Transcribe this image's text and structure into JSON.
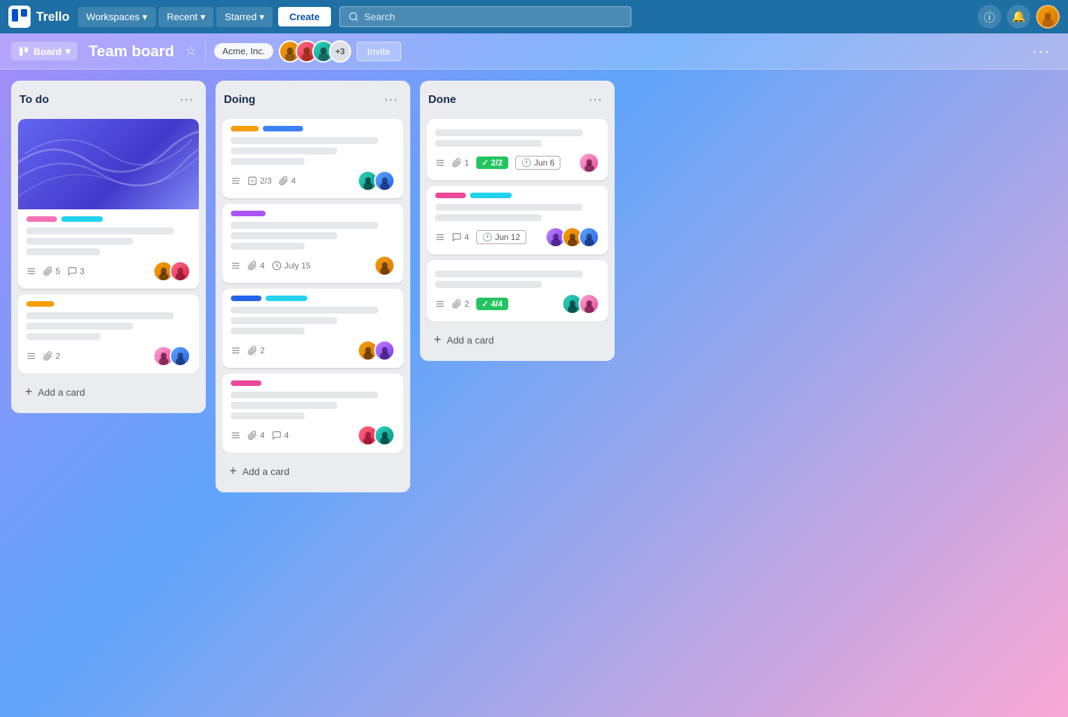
{
  "topnav": {
    "brand": "Trello",
    "workspaces": "Workspaces",
    "recent": "Recent",
    "starred": "Starred",
    "create": "Create",
    "search_placeholder": "Search"
  },
  "board_header": {
    "view_label": "Board",
    "title": "Team board",
    "workspace": "Acme, Inc.",
    "more_members": "+3",
    "invite": "Invite"
  },
  "columns": [
    {
      "id": "todo",
      "title": "To do",
      "cards": [
        {
          "id": "todo-1",
          "has_cover": true,
          "labels": [
            "pink",
            "cyan"
          ],
          "lines": [
            "long",
            "medium",
            "short"
          ],
          "meta": [
            {
              "icon": "☰",
              "text": ""
            },
            {
              "icon": "📎",
              "text": "5"
            },
            {
              "icon": "💬",
              "text": "3"
            }
          ],
          "members": [
            "amber",
            "rose"
          ]
        },
        {
          "id": "todo-2",
          "has_cover": false,
          "labels": [
            "yellow"
          ],
          "lines": [
            "long",
            "medium",
            "short"
          ],
          "meta": [
            {
              "icon": "☰",
              "text": ""
            },
            {
              "icon": "📎",
              "text": "2"
            }
          ],
          "members": [
            "pink",
            "blue"
          ]
        }
      ],
      "add_card": "Add a card"
    },
    {
      "id": "doing",
      "title": "Doing",
      "cards": [
        {
          "id": "doing-1",
          "has_cover": false,
          "labels": [
            "yellow",
            "blue"
          ],
          "lines": [
            "long",
            "medium",
            "short"
          ],
          "meta": [
            {
              "icon": "☰",
              "text": ""
            },
            {
              "icon": "✓",
              "text": "2/3"
            },
            {
              "icon": "📎",
              "text": "4"
            }
          ],
          "members": [
            "teal",
            "blue"
          ]
        },
        {
          "id": "doing-2",
          "has_cover": false,
          "labels": [
            "purple"
          ],
          "lines": [
            "long",
            "medium",
            "short"
          ],
          "meta": [
            {
              "icon": "☰",
              "text": ""
            },
            {
              "icon": "📎",
              "text": "4"
            },
            {
              "icon": "🕐",
              "text": "July 15"
            }
          ],
          "members": [
            "amber"
          ]
        },
        {
          "id": "doing-3",
          "has_cover": false,
          "labels": [
            "blue-dark",
            "cyan"
          ],
          "lines": [
            "long",
            "medium",
            "short"
          ],
          "meta": [
            {
              "icon": "☰",
              "text": ""
            },
            {
              "icon": "📎",
              "text": "2"
            }
          ],
          "members": [
            "amber",
            "purple"
          ]
        },
        {
          "id": "doing-4",
          "has_cover": false,
          "labels": [
            "magenta"
          ],
          "lines": [
            "long",
            "medium",
            "short"
          ],
          "meta": [
            {
              "icon": "☰",
              "text": ""
            },
            {
              "icon": "📎",
              "text": "4"
            },
            {
              "icon": "💬",
              "text": "4"
            }
          ],
          "members": [
            "rose",
            "teal"
          ]
        }
      ],
      "add_card": "Add a card"
    },
    {
      "id": "done",
      "title": "Done",
      "cards": [
        {
          "id": "done-1",
          "has_cover": false,
          "labels": [],
          "lines": [
            "long",
            "medium"
          ],
          "meta": [
            {
              "icon": "☰",
              "text": ""
            },
            {
              "icon": "📎",
              "text": "1"
            }
          ],
          "badges": [
            {
              "type": "green",
              "icon": "✓",
              "text": "2/2"
            },
            {
              "type": "outline",
              "icon": "🕐",
              "text": "Jun 6"
            }
          ],
          "members": [
            "pink"
          ]
        },
        {
          "id": "done-2",
          "has_cover": false,
          "labels": [
            "magenta",
            "teal-label"
          ],
          "lines": [
            "long",
            "medium"
          ],
          "meta": [
            {
              "icon": "☰",
              "text": ""
            },
            {
              "icon": "💬",
              "text": "4"
            }
          ],
          "badges": [
            {
              "type": "outline",
              "icon": "🕐",
              "text": "Jun 12"
            }
          ],
          "members": [
            "purple",
            "amber",
            "blue"
          ]
        },
        {
          "id": "done-3",
          "has_cover": false,
          "labels": [],
          "lines": [
            "long",
            "medium"
          ],
          "meta": [
            {
              "icon": "☰",
              "text": ""
            },
            {
              "icon": "📎",
              "text": "2"
            }
          ],
          "badges": [
            {
              "type": "green",
              "icon": "✓",
              "text": "4/4"
            }
          ],
          "members": [
            "teal",
            "pink"
          ]
        }
      ],
      "add_card": "Add a card"
    }
  ]
}
